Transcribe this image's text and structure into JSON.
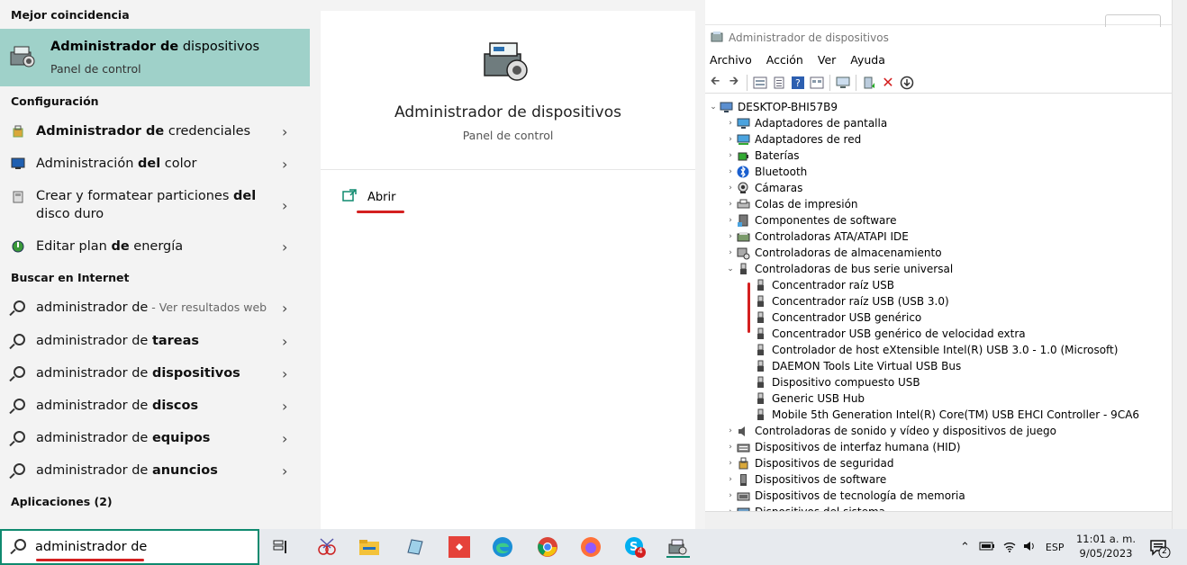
{
  "start_menu": {
    "best_match_header": "Mejor coincidencia",
    "best_match": {
      "title_a": "Administrador ",
      "title_b": "de",
      "title_c": " dispositivos",
      "subtitle": "Panel de control"
    },
    "config_header": "Configuración",
    "config_items": [
      {
        "a": "Administrador ",
        "b": "de",
        "c": " credenciales",
        "icon": "credentials-icon"
      },
      {
        "a": "Administración ",
        "b": "del",
        "c": " color",
        "icon": "color-icon"
      },
      {
        "a": "Crear y formatear particiones ",
        "b": "del",
        "c": " disco duro",
        "icon": "partition-icon"
      },
      {
        "a": "Editar plan ",
        "b": "de",
        "c": " energía",
        "icon": "power-plan-icon"
      }
    ],
    "web_header": "Buscar en Internet",
    "web_items": [
      {
        "a": "administrador de",
        "b": "",
        "sub": " - Ver resultados web"
      },
      {
        "a": "administrador de ",
        "b": "tareas",
        "sub": ""
      },
      {
        "a": "administrador de ",
        "b": "dispositivos",
        "sub": ""
      },
      {
        "a": "administrador de ",
        "b": "discos",
        "sub": ""
      },
      {
        "a": "administrador de ",
        "b": "equipos",
        "sub": ""
      },
      {
        "a": "administrador de ",
        "b": "anuncios",
        "sub": ""
      }
    ],
    "apps_header": "Aplicaciones (2)",
    "preview": {
      "title": "Administrador de dispositivos",
      "subtitle": "Panel de control",
      "open_label": "Abrir"
    },
    "search_value": "administrador  de"
  },
  "device_manager": {
    "title": "Administrador de dispositivos",
    "menu": [
      "Archivo",
      "Acción",
      "Ver",
      "Ayuda"
    ],
    "root": "DESKTOP-BHI57B9",
    "categories": [
      {
        "label": "Adaptadores de pantalla",
        "icon": "display-adapter-icon"
      },
      {
        "label": "Adaptadores de red",
        "icon": "network-adapter-icon"
      },
      {
        "label": "Baterías",
        "icon": "battery-icon"
      },
      {
        "label": "Bluetooth",
        "icon": "bluetooth-icon"
      },
      {
        "label": "Cámaras",
        "icon": "camera-icon"
      },
      {
        "label": "Colas de impresión",
        "icon": "printer-icon"
      },
      {
        "label": "Componentes de software",
        "icon": "software-component-icon"
      },
      {
        "label": "Controladoras ATA/ATAPI IDE",
        "icon": "ide-controller-icon"
      },
      {
        "label": "Controladoras de almacenamiento",
        "icon": "storage-controller-icon"
      },
      {
        "label": "Controladoras de bus serie universal",
        "icon": "usb-icon"
      }
    ],
    "usb_children": [
      "Concentrador raíz USB",
      "Concentrador raíz USB (USB 3.0)",
      "Concentrador USB genérico",
      "Concentrador USB genérico de velocidad extra",
      "Controlador de host eXtensible Intel(R) USB 3.0 - 1.0 (Microsoft)",
      "DAEMON Tools Lite Virtual USB Bus",
      "Dispositivo compuesto USB",
      "Generic USB Hub",
      "Mobile 5th Generation Intel(R) Core(TM) USB EHCI Controller - 9CA6"
    ],
    "categories_after": [
      {
        "label": "Controladoras de sonido y vídeo y dispositivos de juego",
        "icon": "sound-icon"
      },
      {
        "label": "Dispositivos de interfaz humana (HID)",
        "icon": "hid-icon"
      },
      {
        "label": "Dispositivos de seguridad",
        "icon": "security-device-icon"
      },
      {
        "label": "Dispositivos de software",
        "icon": "software-device-icon"
      },
      {
        "label": "Dispositivos de tecnología de memoria",
        "icon": "memory-device-icon"
      },
      {
        "label": "Dispositivos del sistema",
        "icon": "system-device-icon"
      }
    ]
  },
  "taskbar": {
    "language": "ESP",
    "time": "11:01 a. m.",
    "date": "9/05/2023",
    "skype_badge": "4",
    "notification_count": "2"
  }
}
